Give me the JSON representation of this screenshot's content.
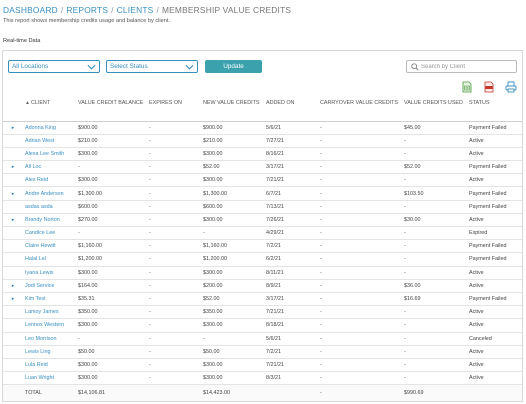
{
  "breadcrumb": {
    "items": [
      "DASHBOARD",
      "REPORTS",
      "CLIENTS"
    ],
    "separator": "/",
    "current": "MEMBERSHIP VALUE CREDITS"
  },
  "subtitle": "This report shows membership credits usage and balance by client.",
  "section_label": "Real-time Data",
  "filters": {
    "location_selected": "All Locations",
    "status_selected": "Select Status",
    "update_label": "Update",
    "search_placeholder": "Search by Client",
    "search_value": ""
  },
  "export_icons": [
    "export-excel-icon",
    "export-pdf-icon",
    "print-icon"
  ],
  "colors": {
    "link": "#3a8fc1",
    "button": "#3aa1ad",
    "excel": "#4a9a3c",
    "pdf": "#c0392b"
  },
  "table": {
    "sort_icon": "sort-up-icon",
    "columns": [
      "CLIENT",
      "VALUE CREDIT BALANCE",
      "EXPIRES ON",
      "NEW VALUE CREDITS",
      "ADDED ON",
      "CARRYOVER VALUE CREDITS",
      "VALUE CREDITS USED",
      "STATUS"
    ],
    "rows": [
      {
        "expand": "▸",
        "client": "Adonna King",
        "balance": "$900.00",
        "expires": "-",
        "new_credits": "$900.00",
        "added": "5/6/21",
        "carryover": "-",
        "used": "$45.00",
        "status": "Payment Failed"
      },
      {
        "expand": "",
        "client": "Adrian West",
        "balance": "$210.00",
        "expires": "-",
        "new_credits": "$210.00",
        "added": "7/27/21",
        "carryover": "-",
        "used": "-",
        "status": "Active"
      },
      {
        "expand": "",
        "client": "Alexa Lee Smith",
        "balance": "$300.00",
        "expires": "-",
        "new_credits": "$300.00",
        "added": "8/16/21",
        "carryover": "-",
        "used": "-",
        "status": "Active"
      },
      {
        "expand": "▸",
        "client": "All Loc",
        "balance": "-",
        "expires": "-",
        "new_credits": "$52.00",
        "added": "3/17/21",
        "carryover": "-",
        "used": "$52.00",
        "status": "Payment Failed"
      },
      {
        "expand": "",
        "client": "Alex Reid",
        "balance": "$300.00",
        "expires": "-",
        "new_credits": "$300.00",
        "added": "7/21/21",
        "carryover": "-",
        "used": "-",
        "status": "Active"
      },
      {
        "expand": "▸",
        "client": "Andre Anderson",
        "balance": "$1,300.00",
        "expires": "-",
        "new_credits": "$1,300.00",
        "added": "6/7/21",
        "carryover": "-",
        "used": "$103.50",
        "status": "Payment Failed"
      },
      {
        "expand": "",
        "client": "asdas asda",
        "balance": "$600.00",
        "expires": "-",
        "new_credits": "$600.00",
        "added": "7/13/21",
        "carryover": "-",
        "used": "-",
        "status": "Payment Failed"
      },
      {
        "expand": "▸",
        "client": "Brandy Norton",
        "balance": "$270.00",
        "expires": "-",
        "new_credits": "$300.00",
        "added": "7/26/21",
        "carryover": "-",
        "used": "$30.00",
        "status": "Active"
      },
      {
        "expand": "",
        "client": "Candice Lee",
        "balance": "-",
        "expires": "-",
        "new_credits": "-",
        "added": "4/29/21",
        "carryover": "-",
        "used": "-",
        "status": "Expired"
      },
      {
        "expand": "",
        "client": "Claire Hewitt",
        "balance": "$1,160.00",
        "expires": "-",
        "new_credits": "$1,160.00",
        "added": "7/2/21",
        "carryover": "-",
        "used": "-",
        "status": "Payment Failed"
      },
      {
        "expand": "",
        "client": "Halal Lel",
        "balance": "$1,200.00",
        "expires": "-",
        "new_credits": "$1,200.00",
        "added": "6/2/21",
        "carryover": "-",
        "used": "-",
        "status": "Payment Failed"
      },
      {
        "expand": "",
        "client": "Iyana Lewis",
        "balance": "$300.00",
        "expires": "-",
        "new_credits": "$300.00",
        "added": "8/11/21",
        "carryover": "-",
        "used": "-",
        "status": "Active"
      },
      {
        "expand": "▸",
        "client": "Jodi Service",
        "balance": "$164.00",
        "expires": "-",
        "new_credits": "$200.00",
        "added": "8/9/21",
        "carryover": "-",
        "used": "$36.00",
        "status": "Active"
      },
      {
        "expand": "▸",
        "client": "Kim Test",
        "balance": "$35.31",
        "expires": "-",
        "new_credits": "$52.00",
        "added": "3/17/21",
        "carryover": "-",
        "used": "$16.69",
        "status": "Payment Failed"
      },
      {
        "expand": "",
        "client": "Lamoy James",
        "balance": "$350.00",
        "expires": "-",
        "new_credits": "$350.00",
        "added": "7/21/21",
        "carryover": "-",
        "used": "-",
        "status": "Active"
      },
      {
        "expand": "",
        "client": "Lennox Western",
        "balance": "$300.00",
        "expires": "-",
        "new_credits": "$300.00",
        "added": "8/18/21",
        "carryover": "-",
        "used": "-",
        "status": "Active"
      },
      {
        "expand": "",
        "client": "Leo Morrison",
        "balance": "-",
        "expires": "-",
        "new_credits": "-",
        "added": "5/6/21",
        "carryover": "-",
        "used": "-",
        "status": "Canceled"
      },
      {
        "expand": "",
        "client": "Lewis Ling",
        "balance": "$50.00",
        "expires": "-",
        "new_credits": "$50.00",
        "added": "7/2/21",
        "carryover": "-",
        "used": "-",
        "status": "Active"
      },
      {
        "expand": "",
        "client": "Lula Reid",
        "balance": "$300.00",
        "expires": "-",
        "new_credits": "$300.00",
        "added": "7/21/21",
        "carryover": "-",
        "used": "-",
        "status": "Active"
      },
      {
        "expand": "",
        "client": "Luan Wright",
        "balance": "$300.00",
        "expires": "-",
        "new_credits": "$300.00",
        "added": "8/3/21",
        "carryover": "-",
        "used": "-",
        "status": "Active"
      }
    ],
    "total": {
      "label": "TOTAL",
      "balance": "$14,106.81",
      "expires": "",
      "new_credits": "$14,423.00",
      "added": "",
      "carryover": "-",
      "used": "$990.69",
      "status": ""
    }
  }
}
